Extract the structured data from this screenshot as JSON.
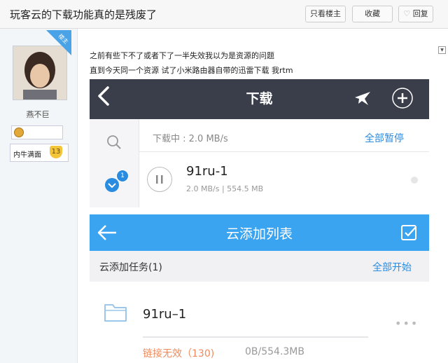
{
  "header": {
    "title": "玩客云的下载功能真的是残废了",
    "btn_only_op": "只看楼主",
    "btn_favorite": "收藏",
    "btn_reply": "回复"
  },
  "author": {
    "corner_badge": "楼主",
    "name": "燕不巨",
    "rank_label": "内牛满面",
    "level": "13"
  },
  "post": {
    "line1": "之前有些下不了或者下了一半失效我以为是资源的问题",
    "line2": "直到今天同一个资源 试了小米路由器自带的迅雷下载 我rtm"
  },
  "download_screen": {
    "title": "下载",
    "status": "下载中 : 2.0 MB/s",
    "pause_all": "全部暂停",
    "badge_count": "1",
    "task_name": "91ru-1",
    "task_stats": "2.0 MB/s | 554.5 MB"
  },
  "cloud_screen": {
    "title": "云添加列表",
    "section": "云添加任务(1)",
    "start_all": "全部开始",
    "task_name": "91ru–1",
    "error": "链接无效（130)",
    "size": "0B/554.3MB"
  },
  "colors": {
    "dark_bar": "#3a3d4a",
    "blue_bar": "#3aa4f0",
    "link_blue": "#2a8ce0",
    "error_orange": "#f08a5d"
  }
}
